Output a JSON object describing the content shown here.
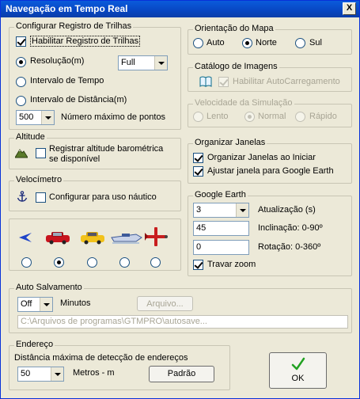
{
  "window": {
    "title": "Navegação em Tempo Real",
    "close_label": "X"
  },
  "trails": {
    "legend": "Configurar Registro de Trilhas",
    "enable_label": "Habilitar Registro de Trilhas",
    "resolution_label": "Resolução(m)",
    "resolution_value": "Full",
    "time_interval_label": "Intervalo de Tempo",
    "distance_interval_label": "Intervalo de Distância(m)",
    "max_points_value": "500",
    "max_points_label": "Número máximo de pontos"
  },
  "altitude": {
    "legend": "Altitude",
    "barometric_label_line1": "Registrar altitude barométrica",
    "barometric_label_line2": "se disponível"
  },
  "speedometer": {
    "legend": "Velocímetro",
    "nautical_label": "Configurar para uso náutico"
  },
  "vehicles": {
    "icons": [
      "arrow-icon",
      "red-car-icon",
      "yellow-car-icon",
      "boat-icon",
      "airplane-icon"
    ],
    "selected_index": 1
  },
  "orientation": {
    "legend": "Orientação do Mapa",
    "auto_label": "Auto",
    "north_label": "Norte",
    "south_label": "Sul"
  },
  "catalog": {
    "legend": "Catálogo de Imagens",
    "autoload_label": "Habilitar AutoCarregamento"
  },
  "simulation": {
    "legend": "Velocidade da Simulação",
    "slow_label": "Lento",
    "normal_label": "Normal",
    "fast_label": "Rápido"
  },
  "windows": {
    "legend": "Organizar Janelas",
    "organize_label": "Organizar Janelas ao Iniciar",
    "adjust_label": "Ajustar janela para Google Earth"
  },
  "google_earth": {
    "legend": "Google Earth",
    "update_value": "3",
    "update_label": "Atualização (s)",
    "tilt_value": "45",
    "tilt_label": "Inclinação: 0-90º",
    "rotation_value": "0",
    "rotation_label": "Rotação: 0-360º",
    "lock_zoom_label": "Travar zoom"
  },
  "autosave": {
    "legend": "Auto Salvamento",
    "interval_value": "Off",
    "minutes_label": "Minutos",
    "file_button": "Arquivo...",
    "path_value": "C:\\Arquivos de programas\\GTMPRO\\autosave..."
  },
  "address": {
    "legend": "Endereço",
    "description": "Distância máxima de detecção de endereços",
    "distance_value": "50",
    "units_label": "Metros - m",
    "default_button": "Padrão"
  },
  "ok_button": {
    "label": "OK"
  },
  "colors": {
    "title_bar": "#0a5bdb",
    "window_bg": "#ece9d8",
    "check_green": "#21a121"
  }
}
